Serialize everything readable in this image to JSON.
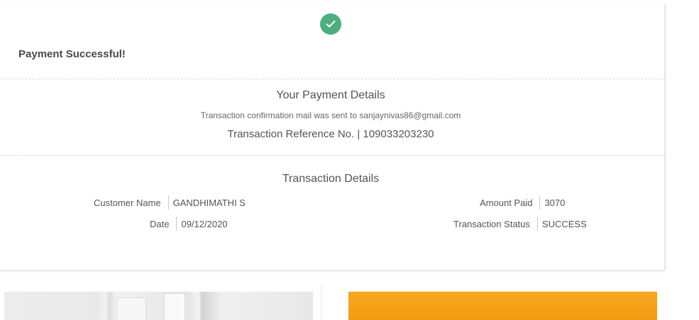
{
  "status": {
    "title": "Payment Successful!",
    "icon": "check-circle-icon",
    "accent_color": "#4caf7d"
  },
  "payment_details": {
    "heading": "Your Payment Details",
    "confirmation_text": "Transaction confirmation mail was sent to sanjaynivas86@gmail.com",
    "reference_text": "Transaction Reference No. | 109033203230"
  },
  "transaction_details": {
    "heading": "Transaction Details",
    "fields": [
      {
        "label": "Customer Name",
        "value": "GANDHIMATHI S"
      },
      {
        "label": "Date",
        "value": "09/12/2020"
      },
      {
        "label": "Amount Paid",
        "value": "3070"
      },
      {
        "label": "Transaction Status",
        "value": "SUCCESS"
      }
    ]
  },
  "promo": {
    "right_color": "#f39c12"
  }
}
